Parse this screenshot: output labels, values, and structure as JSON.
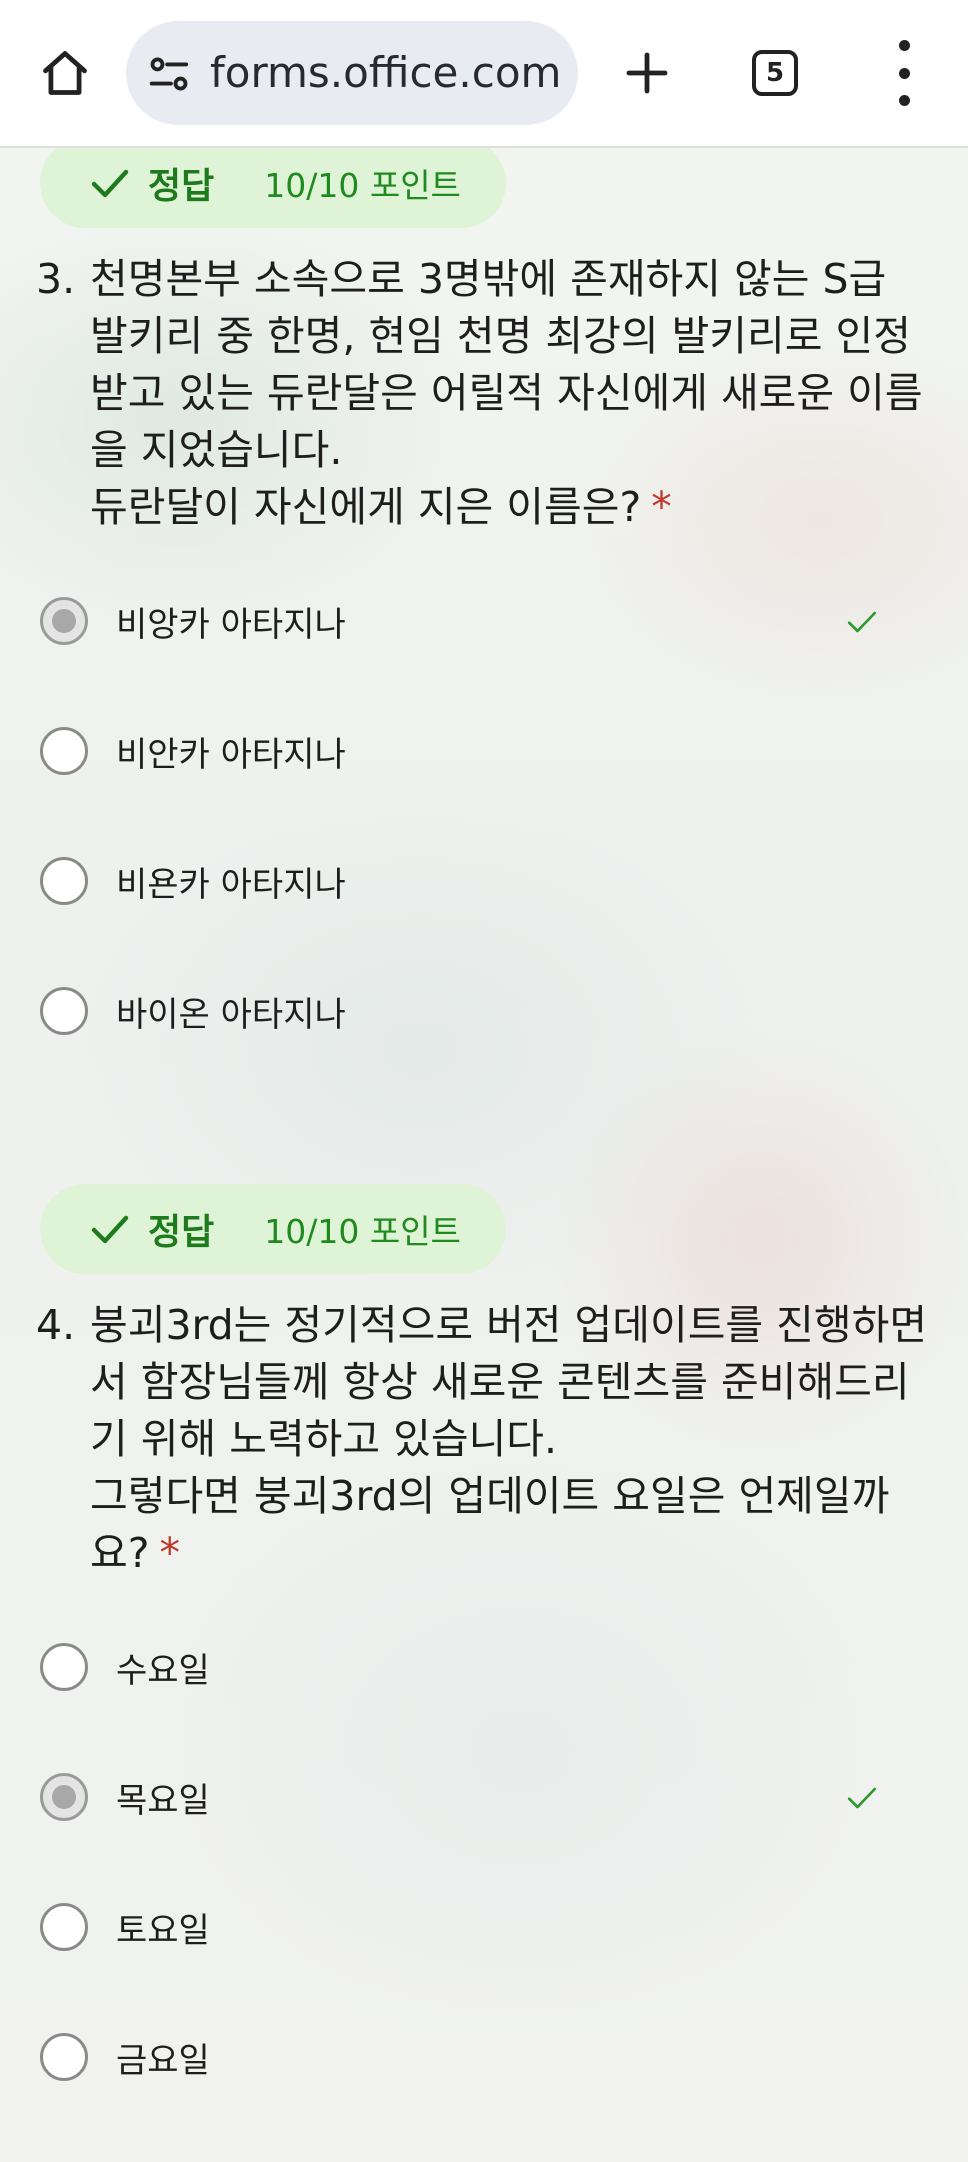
{
  "browser": {
    "url": "forms.office.com/p",
    "tab_count": "5"
  },
  "questions": [
    {
      "badge": {
        "label": "정답",
        "points": "10/10 포인트"
      },
      "number": "3.",
      "lines": [
        "천명본부 소속으로 3명밖에 존재하지 않는 S급",
        "발키리 중 한명, 현임 천명 최강의 발키리로 인정",
        "받고 있는 듀란달은 어릴적 자신에게 새로운 이름",
        "을 지었습니다.",
        "듀란달이 자신에게 지은 이름은?"
      ],
      "required_mark": "*",
      "options": [
        {
          "label": "비앙카 아타지나",
          "selected": true,
          "correct": true
        },
        {
          "label": "비안카 아타지나",
          "selected": false,
          "correct": false
        },
        {
          "label": "비욘카 아타지나",
          "selected": false,
          "correct": false
        },
        {
          "label": "바이온 아타지나",
          "selected": false,
          "correct": false
        }
      ]
    },
    {
      "badge": {
        "label": "정답",
        "points": "10/10 포인트"
      },
      "number": "4.",
      "lines": [
        "붕괴3rd는 정기적으로 버전 업데이트를 진행하면",
        "서 함장님들께 항상 새로운 콘텐츠를 준비해드리",
        "기 위해 노력하고 있습니다.",
        "그렇다면 붕괴3rd의 업데이트 요일은 언제일까",
        "요?"
      ],
      "required_mark": "*",
      "options": [
        {
          "label": "수요일",
          "selected": false,
          "correct": false
        },
        {
          "label": "목요일",
          "selected": true,
          "correct": true
        },
        {
          "label": "토요일",
          "selected": false,
          "correct": false
        },
        {
          "label": "금요일",
          "selected": false,
          "correct": false
        }
      ]
    }
  ],
  "colors": {
    "badge_bg": "#dff3d6",
    "correct_green": "#1d7a1d",
    "required_red": "#c0392b"
  },
  "icons": [
    "home-icon",
    "site-settings-icon",
    "plus-icon",
    "tab-switcher-icon",
    "more-vert-icon",
    "check-icon"
  ]
}
